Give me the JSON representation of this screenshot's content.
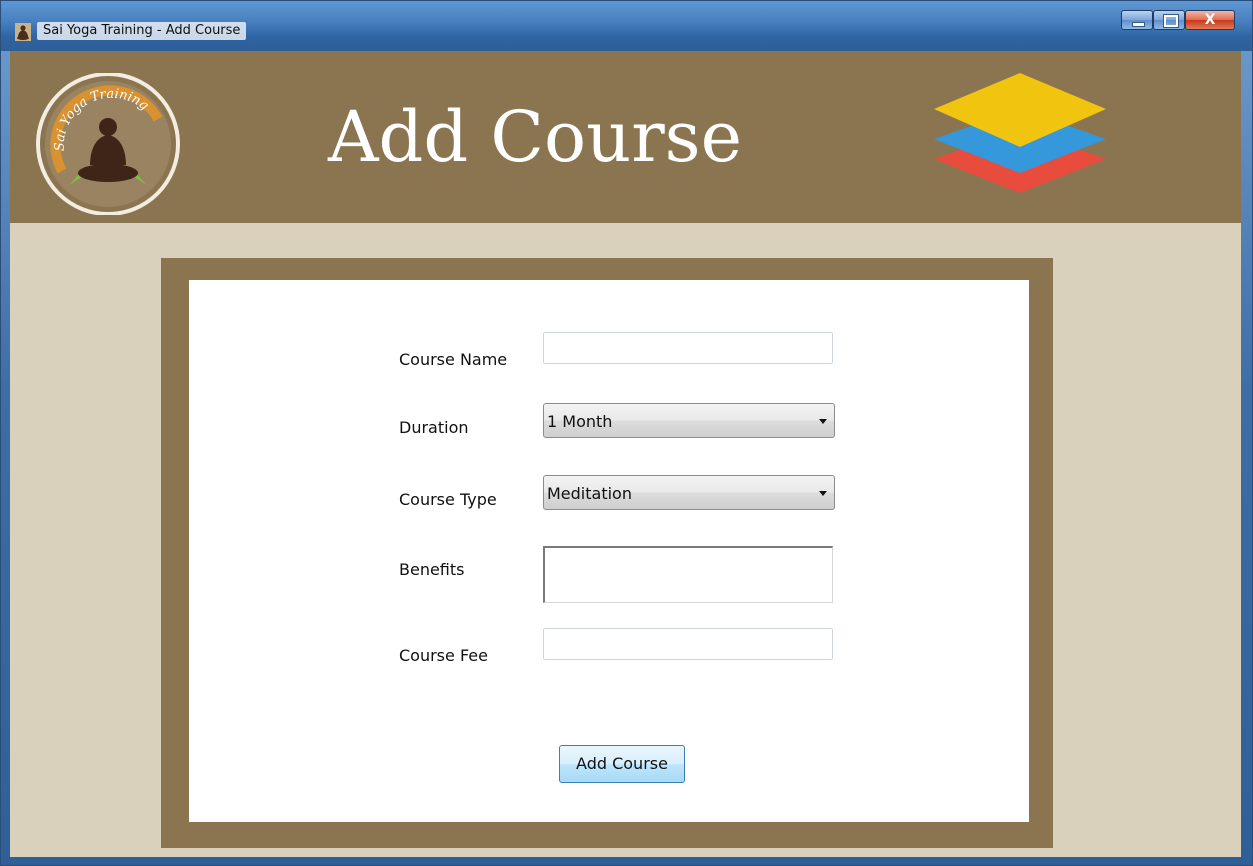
{
  "window": {
    "title": "Sai Yoga Training - Add Course",
    "controls": {
      "minimize": "–",
      "maximize": "□",
      "close": "X"
    }
  },
  "header": {
    "title": "Add Course",
    "logo_text": "Sai Yoga Training",
    "colors": {
      "header_bg": "#8b7550",
      "layer_top": "#f1c40f",
      "layer_mid": "#3498db",
      "layer_bottom": "#e74c3c"
    }
  },
  "form": {
    "course_name": {
      "label": "Course Name",
      "value": ""
    },
    "duration": {
      "label": "Duration",
      "selected": "1 Month"
    },
    "course_type": {
      "label": "Course Type",
      "selected": "Meditation"
    },
    "benefits": {
      "label": "Benefits",
      "value": ""
    },
    "course_fee": {
      "label": "Course Fee",
      "value": ""
    },
    "submit_label": "Add Course"
  }
}
